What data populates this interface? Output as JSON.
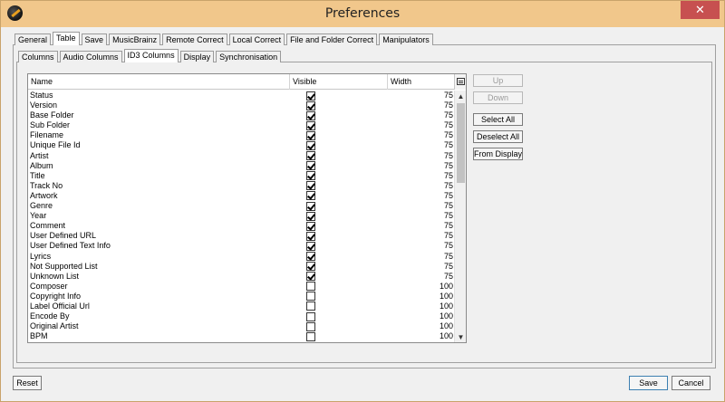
{
  "window": {
    "title": "Preferences",
    "close_glyph": "✕"
  },
  "main_tabs": [
    "General",
    "Table",
    "Save",
    "MusicBrainz",
    "Remote Correct",
    "Local Correct",
    "File and Folder Correct",
    "Manipulators"
  ],
  "sub_tabs": [
    "Columns",
    "Audio Columns",
    "ID3 Columns",
    "Display",
    "Synchronisation"
  ],
  "table": {
    "headers": {
      "name": "Name",
      "visible": "Visible",
      "width": "Width"
    },
    "rows": [
      {
        "name": "Status",
        "visible": true,
        "width": "75"
      },
      {
        "name": "Version",
        "visible": true,
        "width": "75"
      },
      {
        "name": "Base Folder",
        "visible": true,
        "width": "75"
      },
      {
        "name": "Sub Folder",
        "visible": true,
        "width": "75"
      },
      {
        "name": "Filename",
        "visible": true,
        "width": "75"
      },
      {
        "name": "Unique File Id",
        "visible": true,
        "width": "75"
      },
      {
        "name": "Artist",
        "visible": true,
        "width": "75"
      },
      {
        "name": "Album",
        "visible": true,
        "width": "75"
      },
      {
        "name": "Title",
        "visible": true,
        "width": "75"
      },
      {
        "name": "Track No",
        "visible": true,
        "width": "75"
      },
      {
        "name": "Artwork",
        "visible": true,
        "width": "75"
      },
      {
        "name": "Genre",
        "visible": true,
        "width": "75"
      },
      {
        "name": "Year",
        "visible": true,
        "width": "75"
      },
      {
        "name": "Comment",
        "visible": true,
        "width": "75"
      },
      {
        "name": "User Defined URL",
        "visible": true,
        "width": "75"
      },
      {
        "name": "User Defined Text Info",
        "visible": true,
        "width": "75"
      },
      {
        "name": "Lyrics",
        "visible": true,
        "width": "75"
      },
      {
        "name": "Not Supported List",
        "visible": true,
        "width": "75"
      },
      {
        "name": "Unknown List",
        "visible": true,
        "width": "75"
      },
      {
        "name": "Composer",
        "visible": false,
        "width": "100"
      },
      {
        "name": "Copyright Info",
        "visible": false,
        "width": "100"
      },
      {
        "name": "Label Official Url",
        "visible": false,
        "width": "100"
      },
      {
        "name": "Encode By",
        "visible": false,
        "width": "100"
      },
      {
        "name": "Original Artist",
        "visible": false,
        "width": "100"
      },
      {
        "name": "BPM",
        "visible": false,
        "width": "100"
      }
    ]
  },
  "side_buttons": {
    "up": "Up",
    "down": "Down",
    "select_all": "Select All",
    "deselect_all": "Deselect All",
    "from_display": "From Display"
  },
  "footer": {
    "reset": "Reset",
    "save": "Save",
    "cancel": "Cancel"
  },
  "colors": {
    "titlebar": "#f1c78b",
    "close": "#c75050",
    "primary_border": "#3c7fb1"
  }
}
